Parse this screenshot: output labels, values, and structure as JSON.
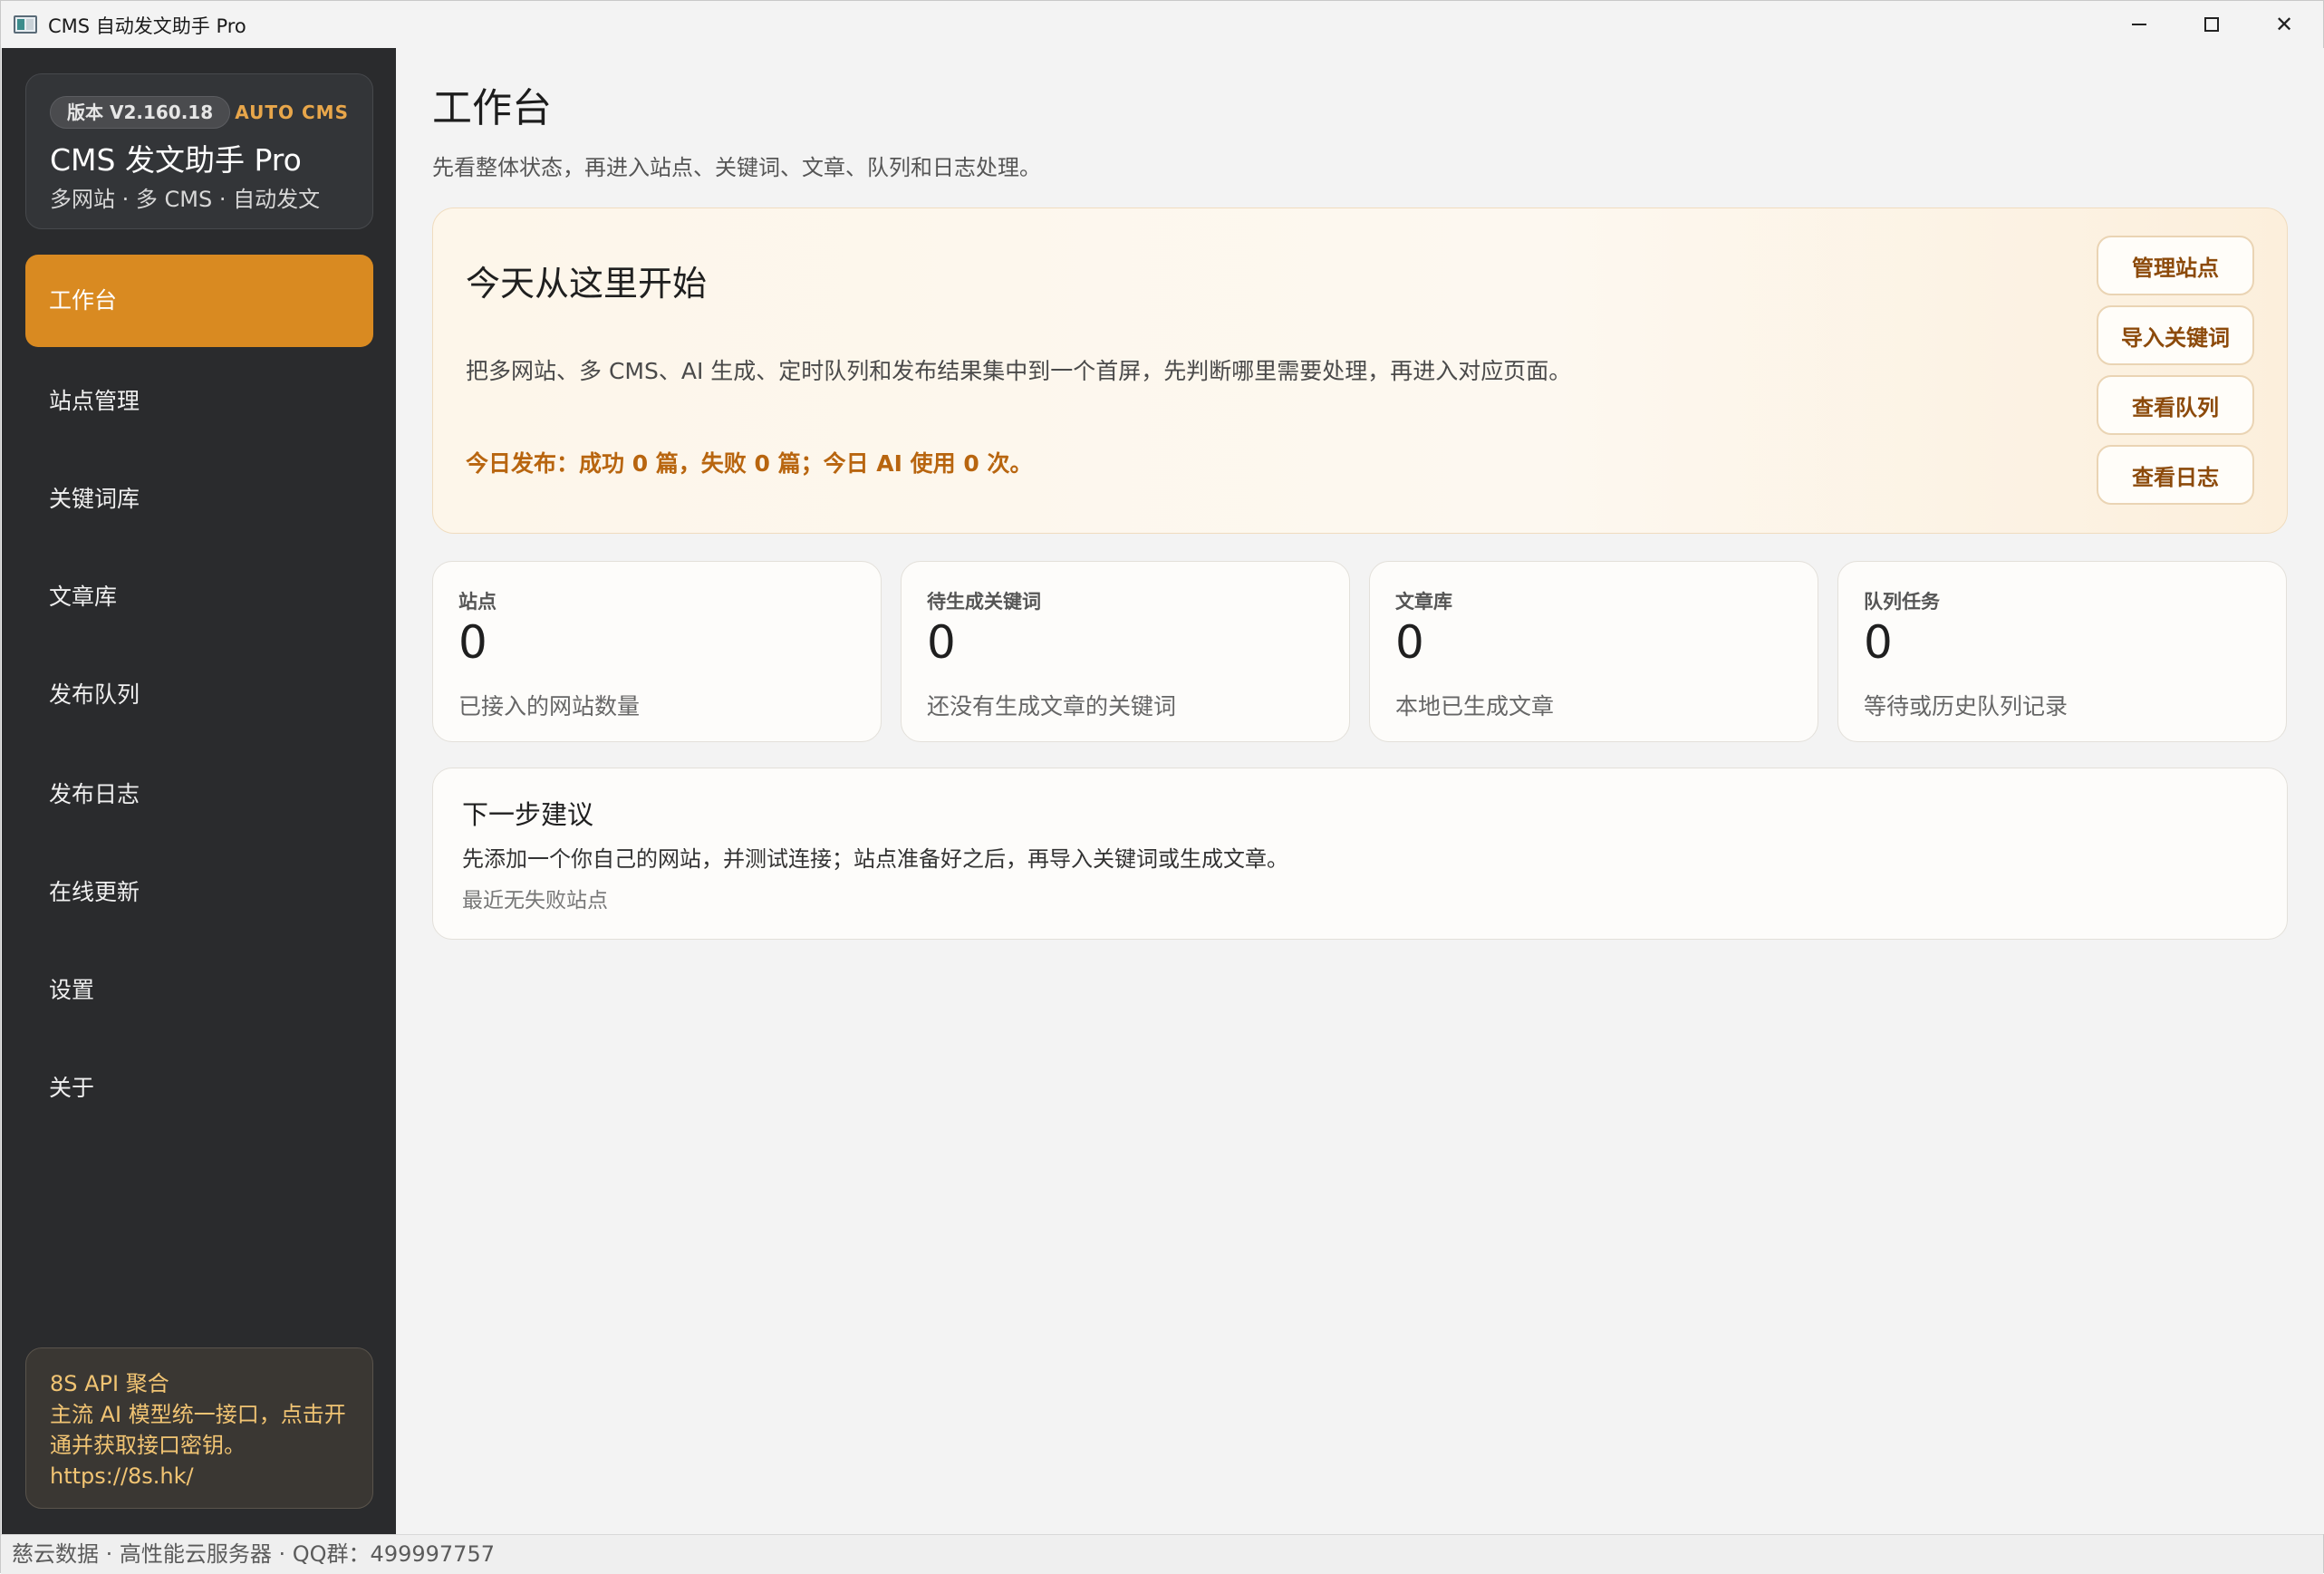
{
  "window": {
    "title": "CMS 自动发文助手 Pro",
    "controls": {
      "minimize": "minimize-icon",
      "maximize": "maximize-icon",
      "close": "✕"
    }
  },
  "sidebar": {
    "brand": {
      "version": "版本 V2.160.18",
      "tag": "AUTO CMS",
      "name": "CMS 发文助手 Pro",
      "subtitle": "多网站 · 多 CMS · 自动发文"
    },
    "items": [
      {
        "label": "工作台",
        "active": true
      },
      {
        "label": "站点管理"
      },
      {
        "label": "关键词库"
      },
      {
        "label": "文章库"
      },
      {
        "label": "发布队列"
      },
      {
        "label": "发布日志"
      },
      {
        "label": "在线更新"
      },
      {
        "label": "设置"
      },
      {
        "label": "关于"
      }
    ],
    "promo": {
      "title": "8S API 聚合",
      "text": "主流 AI 模型统一接口，点击开通并获取接口密钥。",
      "url": "https://8s.hk/"
    }
  },
  "main": {
    "title": "工作台",
    "description": "先看整体状态，再进入站点、关键词、文章、队列和日志处理。",
    "hero": {
      "title": "今天从这里开始",
      "description": "把多网站、多 CMS、AI 生成、定时队列和发布结果集中到一个首屏，先判断哪里需要处理，再进入对应页面。",
      "stats": "今日发布：成功 0 篇，失败 0 篇；今日 AI 使用 0 次。",
      "buttons": [
        "管理站点",
        "导入关键词",
        "查看队列",
        "查看日志"
      ]
    },
    "stats": [
      {
        "label": "站点",
        "value": "0",
        "desc": "已接入的网站数量"
      },
      {
        "label": "待生成关键词",
        "value": "0",
        "desc": "还没有生成文章的关键词"
      },
      {
        "label": "文章库",
        "value": "0",
        "desc": "本地已生成文章"
      },
      {
        "label": "队列任务",
        "value": "0",
        "desc": "等待或历史队列记录"
      }
    ],
    "next": {
      "title": "下一步建议",
      "text": "先添加一个你自己的网站，并测试连接；站点准备好之后，再导入关键词或生成文章。",
      "note": "最近无失败站点"
    }
  },
  "statusbar": {
    "text": "慈云数据 · 高性能云服务器 · QQ群：499997757"
  },
  "colors": {
    "accent": "#d98a21",
    "sidebar": "#2a2b2d",
    "highlight_text": "#b8650f"
  }
}
